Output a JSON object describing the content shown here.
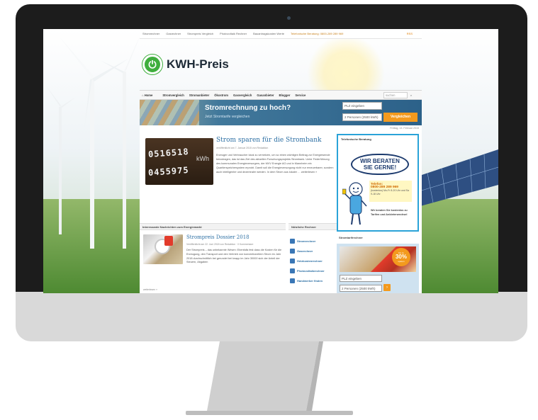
{
  "topbar": {
    "items": [
      "Stromrechner",
      "Gasrechner",
      "Strompreis Vergleich",
      "Photovoltaik Rechner",
      "Bauantragskosten Werte"
    ],
    "hotline": "Telefonische Beratung: 0800-289 289 969",
    "rss": "RSS"
  },
  "logo": {
    "text": "KWH-Preis"
  },
  "nav": {
    "items": [
      "Home",
      "Stromvergleich",
      "Stromanbieter",
      "Ökostrom",
      "Gasvergleich",
      "Gasanbieter",
      "Blogger",
      "Service"
    ],
    "search_placeholder": "suchen"
  },
  "banner": {
    "title": "Stromrechnung zu hoch?",
    "subtitle": "Jetzt Stromtarife vergleichen",
    "plz_placeholder": "PLZ eingeben",
    "persons_value": "2 Personen (2500 kWh)",
    "button": "Vergleichen"
  },
  "date": "Freitag, 13. Februar 2015",
  "feature": {
    "title": "Strom sparen für die Strombank",
    "meta": "veröffentlicht am 7. Januar 2015 von Redaktion",
    "body": "Erzeuger und Verbraucher lokal zu vernetzen, um so einen wichtigen Beitrag zur Energiewende beizutragen, das ist das Ziel des aktuellen Forschungsprojekts Strombank. Unter Federführung des kommunalen Energieversorgers, der MVV Energie AG und in Mannheim ein Quartierspeichersystem erprobt. Damit soll die Energieversorgung nicht nur erneuerbarer, sondern auch intelligenter und dezentraler werden. In dem Strom aus lokaler …  weiterlesen »",
    "meter_digits_1": "0516518",
    "meter_digits_2": "0455975",
    "meter_unit": "kWh"
  },
  "news": {
    "head": "Interessante Nachrichten zum Energiemarkt",
    "title": "Strompreis Dossier 2018",
    "meta": "Veröffentlicht am 22. Juni 2018 von Redaktion · 0 Kommentare",
    "body": "Der Strompreis – das unbekannte Wesen: Ebenfalls fest dass die Kosten für die Erzeugung, den Transport und den Vertrieb von konventionellem Strom im Jahr 2018 durchschnittlich bei gerundet bei knapp im Jahr 30000 sich der Anteil der Steuern, Abgaben",
    "more": "weiterlesen »"
  },
  "links": {
    "head": "Nützliche Rechner",
    "items": [
      "Stromrechner",
      "Gasrechner",
      "Heizkostenrechner",
      "Photovoltaikrechner",
      "Handwerker finden"
    ]
  },
  "advice": {
    "head": "Telefonische Beratung",
    "bubble_line1": "WIR BERATEN",
    "bubble_line2": "SIE GERNE!",
    "phone_label": "Telefon:",
    "phone_number": "0800-289 289 969",
    "hours": "(kostenlos) Mo-Fr 8-20 Uhr und Sa 9-18 Uhr",
    "text": "Wir beraten Sie kostenlos zu Tarifen und Anbieterwechsel"
  },
  "rechner": {
    "head": "Stromtarifrechner",
    "deal_top": "bis zu",
    "deal_value": "30%",
    "deal_bottom": "sparen",
    "plz_placeholder": "PLZ eingeben",
    "persons_value": "2 Personen (2500 kWh)"
  },
  "colors": {
    "accent_blue": "#2b6ea3",
    "brand_green": "#3fae3d",
    "cta_orange": "#f39a1e",
    "highlight_border": "#2aa3d8"
  }
}
